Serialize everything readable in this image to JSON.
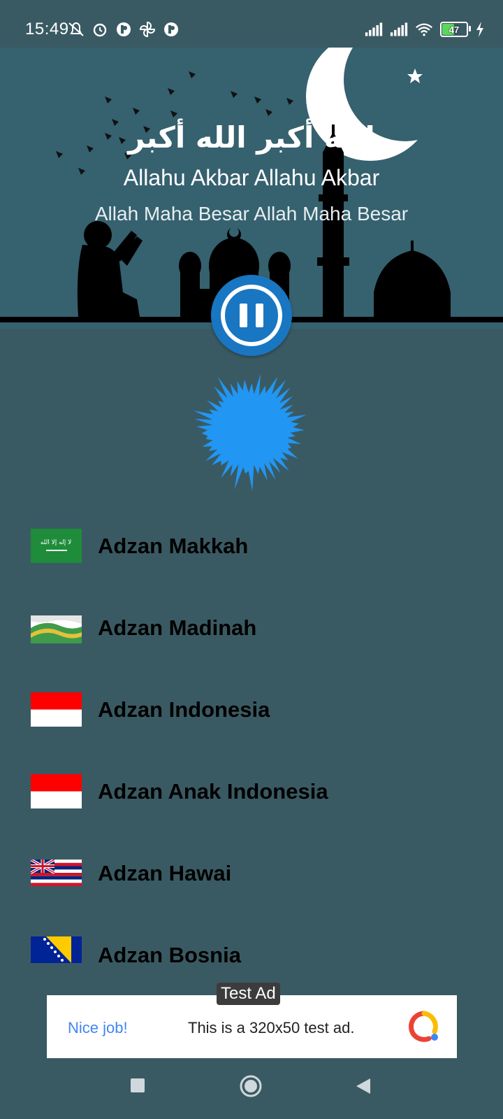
{
  "status_bar": {
    "time": "15:49",
    "battery_percent": "47",
    "left_icons": [
      "mute-icon",
      "alarm-icon",
      "app-icon",
      "pinwheel-icon",
      "app-icon"
    ],
    "right_icons": [
      "signal-icon",
      "signal-icon",
      "wifi-icon",
      "battery-icon",
      "charging-icon"
    ]
  },
  "header": {
    "arabic": "الله أكبر الله أكبر",
    "latin": "Allahu Akbar Allahu Akbar",
    "meaning": "Allah Maha Besar Allah Maha Besar"
  },
  "player": {
    "state_icon": "pause-icon",
    "accent_color": "#1976c2",
    "visualizer_color": "#2196f3"
  },
  "adzan_list": [
    {
      "label": "Adzan Makkah",
      "flag": "saudi-arabia-flag"
    },
    {
      "label": "Adzan Madinah",
      "flag": "madinah-flag"
    },
    {
      "label": "Adzan Indonesia",
      "flag": "indonesia-flag"
    },
    {
      "label": "Adzan Anak Indonesia",
      "flag": "indonesia-flag"
    },
    {
      "label": "Adzan Hawai",
      "flag": "hawaii-flag"
    },
    {
      "label": "Adzan Bosnia",
      "flag": "bosnia-flag"
    }
  ],
  "ad": {
    "tag": "Test Ad",
    "nice_label": "Nice job!",
    "message": "This is a 320x50 test ad."
  },
  "navigation": {
    "recent_icon": "square-icon",
    "home_icon": "circle-icon",
    "back_icon": "triangle-back-icon"
  }
}
